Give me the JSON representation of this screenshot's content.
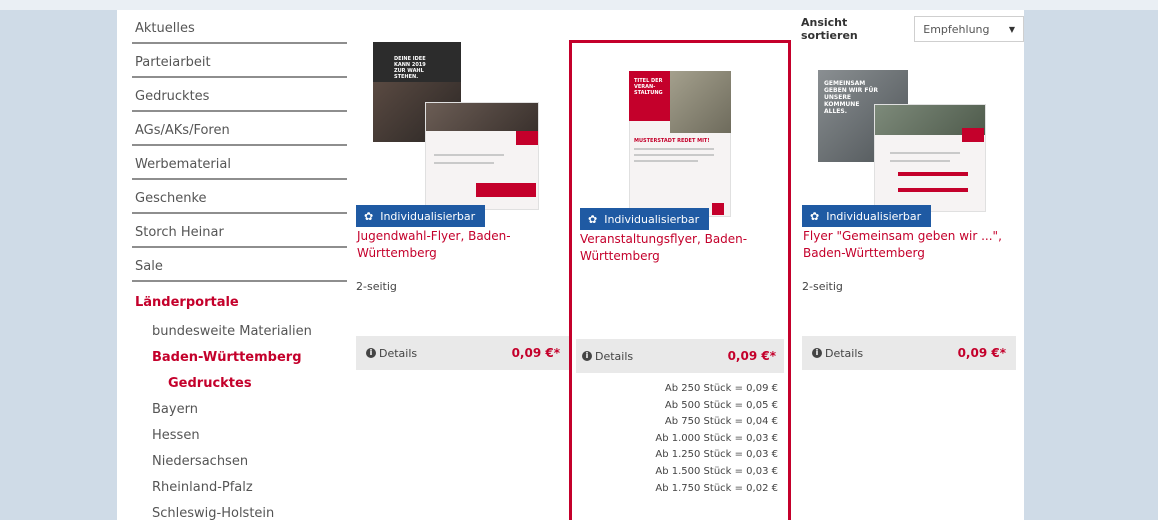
{
  "sidebar": {
    "items": [
      {
        "label": "Aktuelles"
      },
      {
        "label": "Parteiarbeit"
      },
      {
        "label": "Gedrucktes"
      },
      {
        "label": "AGs/AKs/Foren"
      },
      {
        "label": "Werbematerial"
      },
      {
        "label": "Geschenke"
      },
      {
        "label": "Storch Heinar"
      },
      {
        "label": "Sale"
      }
    ],
    "active_section": "Länderportale",
    "sub_items": [
      {
        "label": "bundesweite Materialien"
      },
      {
        "label": "Baden-Württemberg"
      },
      {
        "label": "Gedrucktes"
      },
      {
        "label": "Bayern"
      },
      {
        "label": "Hessen"
      },
      {
        "label": "Niedersachsen"
      },
      {
        "label": "Rheinland-Pfalz"
      },
      {
        "label": "Schleswig-Holstein"
      }
    ]
  },
  "sort": {
    "label": "Ansicht sortieren",
    "selected": "Empfehlung"
  },
  "products": [
    {
      "badge": "Individualisierbar",
      "title": "Jugendwahl-Flyer, Baden-Württemberg",
      "description": "2-seitig",
      "details": "Details",
      "price": "0,09 €*",
      "image_text": "DEINE IDEE KANN 2019 ZUR WAHL STEHEN."
    },
    {
      "badge": "Individualisierbar",
      "title": "Veranstaltungsflyer, Baden-Württemberg",
      "description": "",
      "details": "Details",
      "price": "0,09 €*",
      "image_text": "TITEL DER VERAN-STALTUNG",
      "image_subtext": "MUSTERSTADT REDET MIT!",
      "tiers": [
        "Ab 250 Stück = 0,09 €",
        "Ab 500 Stück = 0,05 €",
        "Ab 750 Stück = 0,04 €",
        "Ab 1.000 Stück = 0,03 €",
        "Ab 1.250 Stück = 0,03 €",
        "Ab 1.500 Stück = 0,03 €",
        "Ab 1.750 Stück = 0,02 €"
      ]
    },
    {
      "badge": "Individualisierbar",
      "title": "Flyer \"Gemeinsam geben wir ...\", Baden-Württemberg",
      "description": "2-seitig",
      "details": "Details",
      "price": "0,09 €*",
      "image_text": "GEMEINSAM GEBEN WIR FÜR UNSERE KOMMUNE ALLES."
    }
  ],
  "colors": {
    "accent_red": "#c4002b",
    "badge_blue": "#1f5aa3",
    "background": "#cfdbe7"
  }
}
